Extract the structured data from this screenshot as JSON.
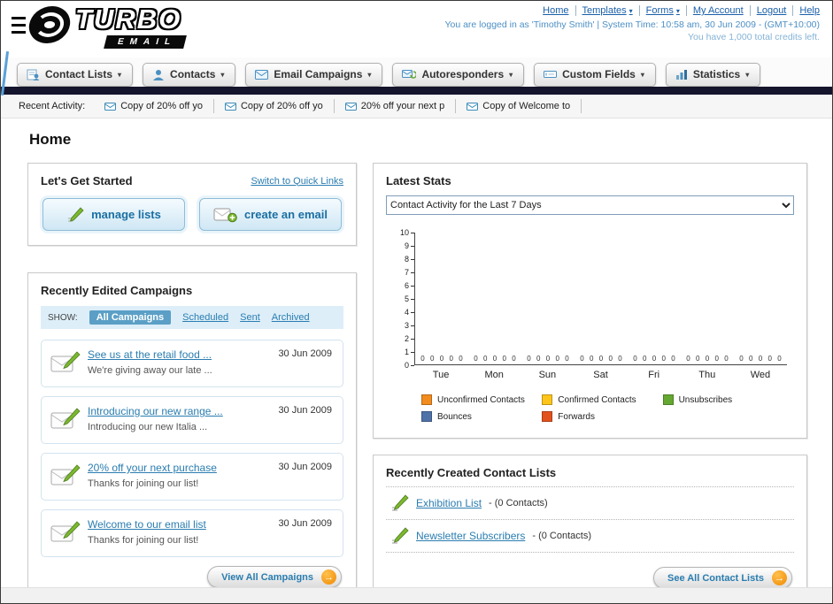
{
  "ui": {
    "caret": "▾",
    "arrow_glyph": "→"
  },
  "colors": {
    "accent_blue": "#2a7db0",
    "dark_bar": "#15152e",
    "button_orange": "#ef8800",
    "light_blue_panel": "#ddeef9"
  },
  "header": {
    "logo": {
      "title": "TURBO",
      "subtitle": "EMAIL"
    },
    "links": [
      {
        "label": "Home",
        "dropdown": false
      },
      {
        "label": "Templates",
        "dropdown": true
      },
      {
        "label": "Forms",
        "dropdown": true
      },
      {
        "label": "My Account",
        "dropdown": false
      },
      {
        "label": "Logout",
        "dropdown": false
      },
      {
        "label": "Help",
        "dropdown": false
      }
    ],
    "login_info": "You are logged in as 'Timothy Smith' | System Time: 10:58 am, 30 Jun 2009 - (GMT+10:00)",
    "credits_info": "You have 1,000 total credits left."
  },
  "nav": {
    "items": [
      {
        "label": "Contact Lists"
      },
      {
        "label": "Contacts"
      },
      {
        "label": "Email Campaigns"
      },
      {
        "label": "Autoresponders"
      },
      {
        "label": "Custom Fields"
      },
      {
        "label": "Statistics"
      }
    ]
  },
  "recent_activity": {
    "label": "Recent Activity:",
    "items": [
      {
        "text": "Copy of 20% off yo"
      },
      {
        "text": "Copy of 20% off yo"
      },
      {
        "text": "20% off your next p"
      },
      {
        "text": "Copy of Welcome to"
      }
    ]
  },
  "page": {
    "title": "Home"
  },
  "get_started": {
    "title": "Let's Get Started",
    "switch_link": "Switch to Quick Links",
    "buttons": [
      {
        "label": "manage lists"
      },
      {
        "label": "create an email"
      }
    ]
  },
  "campaigns": {
    "title": "Recently Edited Campaigns",
    "show_label": "SHOW:",
    "tabs": [
      "All Campaigns",
      "Scheduled",
      "Sent",
      "Archived"
    ],
    "active_tab": "All Campaigns",
    "items": [
      {
        "title": "See us at the retail food ...",
        "subtitle": "We're giving away our late ...",
        "date": "30 Jun 2009"
      },
      {
        "title": "Introducing our new range ...",
        "subtitle": "Introducing our new Italia ...",
        "date": "30 Jun 2009"
      },
      {
        "title": "20% off your next purchase",
        "subtitle": "Thanks for joining our list!",
        "date": "30 Jun 2009"
      },
      {
        "title": "Welcome to our email list",
        "subtitle": "Thanks for joining our list!",
        "date": "30 Jun 2009"
      }
    ],
    "view_all_label": "View All Campaigns"
  },
  "stats": {
    "title": "Latest Stats",
    "dropdown_value": "Contact Activity for the Last 7 Days"
  },
  "chart_data": {
    "type": "bar",
    "title": "Contact Activity for the Last 7 Days",
    "categories": [
      "Tue",
      "Mon",
      "Sun",
      "Sat",
      "Fri",
      "Thu",
      "Wed"
    ],
    "series": [
      {
        "name": "Unconfirmed Contacts",
        "color": "#f28c1e",
        "values": [
          0,
          0,
          0,
          0,
          0,
          0,
          0
        ]
      },
      {
        "name": "Confirmed Contacts",
        "color": "#fdc51b",
        "values": [
          0,
          0,
          0,
          0,
          0,
          0,
          0
        ]
      },
      {
        "name": "Unsubscribes",
        "color": "#64a832",
        "values": [
          0,
          0,
          0,
          0,
          0,
          0,
          0
        ]
      },
      {
        "name": "Bounces",
        "color": "#4f72a8",
        "values": [
          0,
          0,
          0,
          0,
          0,
          0,
          0
        ]
      },
      {
        "name": "Forwards",
        "color": "#e2521f",
        "values": [
          0,
          0,
          0,
          0,
          0,
          0,
          0
        ]
      }
    ],
    "ylim": [
      0,
      10
    ],
    "ytick_step": 1,
    "grid": false,
    "legend_position": "bottom"
  },
  "contact_lists": {
    "title": "Recently Created Contact Lists",
    "items": [
      {
        "name": "Exhibition List",
        "detail": "- (0 Contacts)"
      },
      {
        "name": "Newsletter Subscribers",
        "detail": "- (0 Contacts)"
      }
    ],
    "see_all_label": "See All Contact Lists"
  }
}
